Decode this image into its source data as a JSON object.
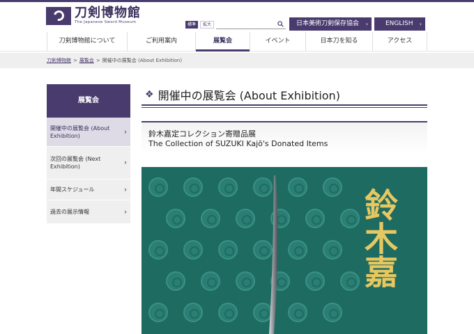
{
  "header": {
    "logo_title": "刀剣博物館",
    "logo_sub": "The Japanese Sword Museum",
    "font_size_standard": "標準",
    "font_size_large": "拡大",
    "search_placeholder": "",
    "association_button": "日本美術刀剣保存協会",
    "english_button": "ENGLISH",
    "arrow": "›"
  },
  "nav": {
    "items": [
      {
        "label": "刀剣博物館について"
      },
      {
        "label": "ご利用案内"
      },
      {
        "label": "展覧会"
      },
      {
        "label": "イベント"
      },
      {
        "label": "日本刀を知る"
      },
      {
        "label": "アクセス"
      }
    ],
    "active_index": 2
  },
  "breadcrumb": {
    "home": "刀剣博物館",
    "exhibitions": "展覧会",
    "current": "開催中の展覧会 (About Exhibition)",
    "separator": ">"
  },
  "sidebar": {
    "heading": "展覧会",
    "items": [
      {
        "label": "開催中の展覧会 (About Exhibition)",
        "active": true
      },
      {
        "label": "次回の展覧会 (Next Exhibition)",
        "active": false
      },
      {
        "label": "年間スケジュール",
        "active": false
      },
      {
        "label": "過去の展示情報",
        "active": false
      }
    ],
    "chevron": "›"
  },
  "main": {
    "title_marker": "❖",
    "title": "開催中の展覧会 (About Exhibition)",
    "exhibition_title_ja": "鈴木嘉定コレクション寄贈品展",
    "exhibition_title_en": "The Collection of SUZUKI Kajō's Donated Items",
    "poster_text": "鈴木嘉"
  },
  "colors": {
    "brand": "#4a3b6e",
    "poster_bg": "#1e6b62",
    "poster_text": "#e7c760"
  }
}
